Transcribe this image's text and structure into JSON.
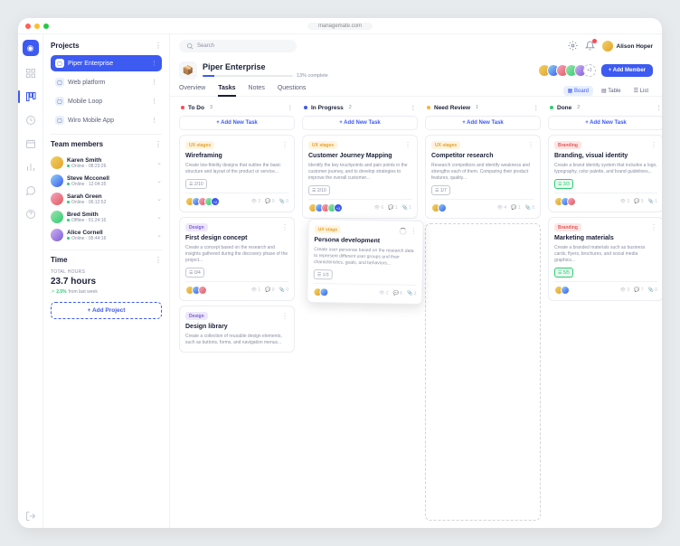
{
  "url": "managemate.com",
  "user": {
    "name": "Alison Hoper"
  },
  "sidebar": {
    "projects_title": "Projects",
    "projects": [
      {
        "name": "Piper Enterprise",
        "active": true
      },
      {
        "name": "Web platform",
        "active": false
      },
      {
        "name": "Mobile Loop",
        "active": false
      },
      {
        "name": "Wiro Mobile App",
        "active": false
      }
    ],
    "members_title": "Team members",
    "members": [
      {
        "name": "Karen Smith",
        "status": "Online",
        "time": "08:23:26",
        "c": "c1"
      },
      {
        "name": "Steve Mcconell",
        "status": "Online",
        "time": "12:04:35",
        "c": "c2"
      },
      {
        "name": "Sarah Green",
        "status": "Online",
        "time": "06:12:52",
        "c": "c3"
      },
      {
        "name": "Bred Smith",
        "status": "Offline",
        "time": "01:24:16",
        "c": "c4"
      },
      {
        "name": "Alice Cornell",
        "status": "Online",
        "time": "05:44:16",
        "c": "c5"
      }
    ],
    "time_title": "Time",
    "time_label": "TOTAL HOURS",
    "time_value": "23.7 hours",
    "time_delta": "2.5%",
    "time_delta_label": "from last week",
    "add_project": "+ Add Project"
  },
  "search_placeholder": "Search",
  "project": {
    "name": "Piper Enterprise",
    "progress_pct": 13,
    "progress_label": "13% complete",
    "extra_members": "+3",
    "add_member": "+  Add Member"
  },
  "tabs": [
    "Overview",
    "Tasks",
    "Notes",
    "Questions"
  ],
  "active_tab": "Tasks",
  "views": [
    {
      "label": "Board",
      "active": true
    },
    {
      "label": "Table",
      "active": false
    },
    {
      "label": "List",
      "active": false
    }
  ],
  "add_task_label": "+  Add New Task",
  "columns": [
    {
      "name": "To Do",
      "count": 3,
      "color": "#ff4757",
      "cards": [
        {
          "tag": "UX stages",
          "tag_class": "ux",
          "title": "Wireframing",
          "desc": "Create low-fidelity designs that outline the basic structure and layout of the product or service...",
          "sub": "2/10",
          "sub_done": false,
          "avatars": 4,
          "more_av": "+2",
          "views": 2,
          "comments": 0,
          "files": 0
        },
        {
          "tag": "Design",
          "tag_class": "design",
          "title": "First design concept",
          "desc": "Create a concept based on the research and insights gathered during the discovery phase of the project...",
          "sub": "0/4",
          "sub_done": false,
          "avatars": 3,
          "views": 1,
          "comments": 0,
          "files": 0
        },
        {
          "tag": "Design",
          "tag_class": "design",
          "title": "Design library",
          "desc": "Create a collection of reusable design elements, such as buttons, forms, and navigation menus...",
          "sub": "",
          "avatars": 0
        }
      ]
    },
    {
      "name": "In Progress",
      "count": 2,
      "color": "#3d5af1",
      "cards": [
        {
          "tag": "UX stages",
          "tag_class": "ux",
          "title": "Customer Journey Mapping",
          "desc": "Identify the key touchpoints and pain points in the customer journey, and to develop strategies to improve the overall customer...",
          "sub": "2/10",
          "sub_done": false,
          "avatars": 4,
          "more_av": "+3",
          "views": 6,
          "comments": 1,
          "files": 1
        },
        {
          "tag": "UX stage",
          "tag_class": "ux",
          "title": "Persona development",
          "desc": "Create user personas based on the research data to represent different user groups and their characteristics, goals, and behaviors...",
          "sub": "1/3",
          "sub_done": false,
          "avatars": 2,
          "views": 2,
          "comments": 6,
          "files": 3,
          "floating": true,
          "loading": true
        }
      ]
    },
    {
      "name": "Need Review",
      "count": 1,
      "color": "#f5b342",
      "cards": [
        {
          "tag": "UX stages",
          "tag_class": "ux",
          "title": "Competitor research",
          "desc": "Research competitors and identify weakness and strengths each of them. Comparing their product features, quality...",
          "sub": "1/7",
          "sub_done": false,
          "avatars": 2,
          "views": 4,
          "comments": 1,
          "files": 0
        }
      ],
      "placeholder": true
    },
    {
      "name": "Done",
      "count": 2,
      "color": "#2ecc71",
      "cards": [
        {
          "tag": "Branding",
          "tag_class": "brand",
          "title": "Branding, visual identity",
          "desc": "Create a brand identity system that includes a logo, typography, color palette, and brand guidelines...",
          "sub": "3/3",
          "sub_done": true,
          "avatars": 3,
          "views": 3,
          "comments": 5,
          "files": 1
        },
        {
          "tag": "Branding",
          "tag_class": "brand",
          "title": "Marketing materials",
          "desc": "Create a branded materials such as business cards, flyers, brochures, and social media graphics...",
          "sub": "5/5",
          "sub_done": true,
          "avatars": 2,
          "views": 3,
          "comments": 7,
          "files": 0
        }
      ]
    }
  ]
}
